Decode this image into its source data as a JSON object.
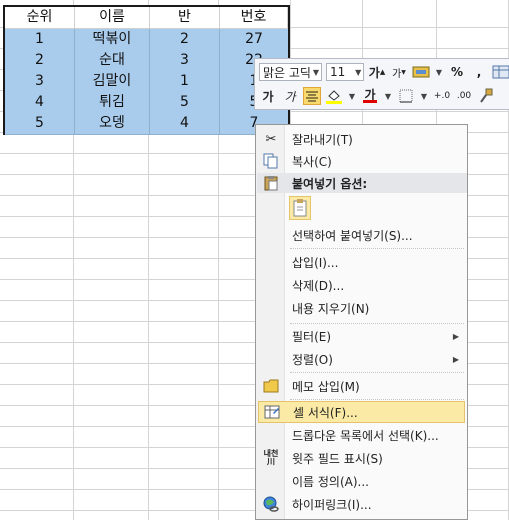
{
  "table": {
    "headers": [
      "순위",
      "이름",
      "반",
      "번호"
    ],
    "rows": [
      [
        "1",
        "떡볶이",
        "2",
        "27"
      ],
      [
        "2",
        "순대",
        "3",
        "22"
      ],
      [
        "3",
        "김말이",
        "1",
        "1"
      ],
      [
        "4",
        "튀김",
        "5",
        "5"
      ],
      [
        "5",
        "오뎅",
        "4",
        "7"
      ]
    ]
  },
  "mini_toolbar": {
    "font_name": "맑은 고딕",
    "font_size": "11",
    "grow_font": "가",
    "shrink_font": "가",
    "percent": "%",
    "comma": ",",
    "bold": "가",
    "italic": "가",
    "font_color_letter": "가",
    "inc_decimal": "+.0",
    "dec_decimal": ".00"
  },
  "context_menu": {
    "cut": "잘라내기(T)",
    "copy": "복사(C)",
    "paste_options": "붙여넣기 옵션:",
    "paste_special": "선택하여 붙여넣기(S)...",
    "insert": "삽입(I)...",
    "delete": "삭제(D)...",
    "clear_contents": "내용 지우기(N)",
    "filter": "필터(E)",
    "sort": "정렬(O)",
    "insert_comment": "메모 삽입(M)",
    "format_cells": "셀 서식(F)...",
    "pick_from_list": "드롭다운 목록에서 선택(K)...",
    "phonetic": "윗주 필드 표시(S)",
    "define_name": "이름 정의(A)...",
    "hyperlink": "하이퍼링크(I)...",
    "phonetic_icon_text": "내천\n川"
  },
  "colors": {
    "selection": "#a9cbec",
    "highlight": "#fbeaa5",
    "menu_bg": "#fafafa"
  }
}
